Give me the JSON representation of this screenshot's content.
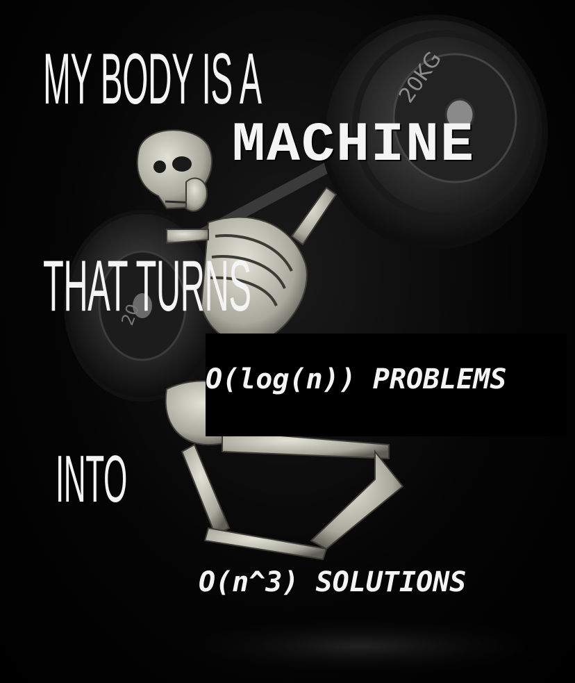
{
  "meme": {
    "line1": "MY BODY IS A",
    "line2": "MACHINE",
    "line3": "THAT TURNS",
    "line4": "O(log(n)) PROBLEMS",
    "line5": "INTO",
    "line6": "O(n^3) SOLUTIONS",
    "plate_label": "20KG",
    "plate_label_small": "20"
  },
  "colors": {
    "text": "#f4f4f4",
    "background": "#000000",
    "bone": "#c9c8bd",
    "plate": "#2a2a2a"
  }
}
